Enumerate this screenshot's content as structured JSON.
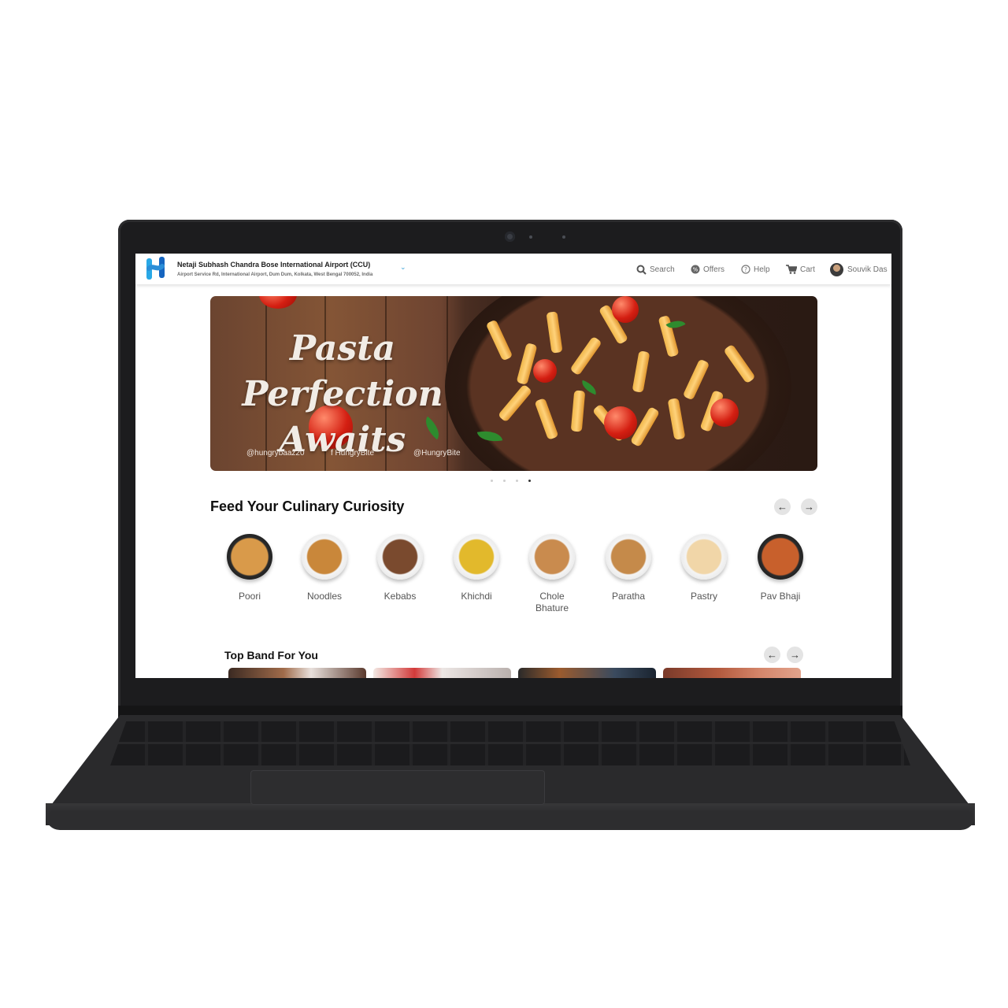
{
  "header": {
    "location_title": "Netaji Subhash Chandra Bose International Airport (CCU)",
    "location_address": "Airport Service Rd, International Airport, Dum Dum, Kolkata, West Bengal 700052, India",
    "nav": {
      "search": "Search",
      "offers": "Offers",
      "help": "Help",
      "cart": "Cart",
      "user": "Souvik Das"
    }
  },
  "hero": {
    "title_line1": "Pasta Perfection",
    "title_line2": "Awaits",
    "handles": [
      "@hungrybaaz20",
      "f HungryBite",
      "@HungryBite"
    ],
    "slides": 4,
    "active_slide": 4
  },
  "culinary": {
    "title": "Feed Your Culinary Curiosity",
    "categories": [
      {
        "label": "Poori",
        "icon": "poori-dish-icon"
      },
      {
        "label": "Noodles",
        "icon": "noodles-dish-icon"
      },
      {
        "label": "Kebabs",
        "icon": "kebabs-dish-icon"
      },
      {
        "label": "Khichdi",
        "icon": "khichdi-dish-icon"
      },
      {
        "label": "Chole Bhature",
        "icon": "chole-bhature-dish-icon"
      },
      {
        "label": "Paratha",
        "icon": "paratha-dish-icon"
      },
      {
        "label": "Pastry",
        "icon": "pastry-dish-icon"
      },
      {
        "label": "Pav Bhaji",
        "icon": "pav-bhaji-dish-icon"
      }
    ]
  },
  "top_band": {
    "title": "Top Band For You"
  },
  "colors": {
    "accent": "#3aa3d8",
    "logo_dark": "#1565c0"
  }
}
